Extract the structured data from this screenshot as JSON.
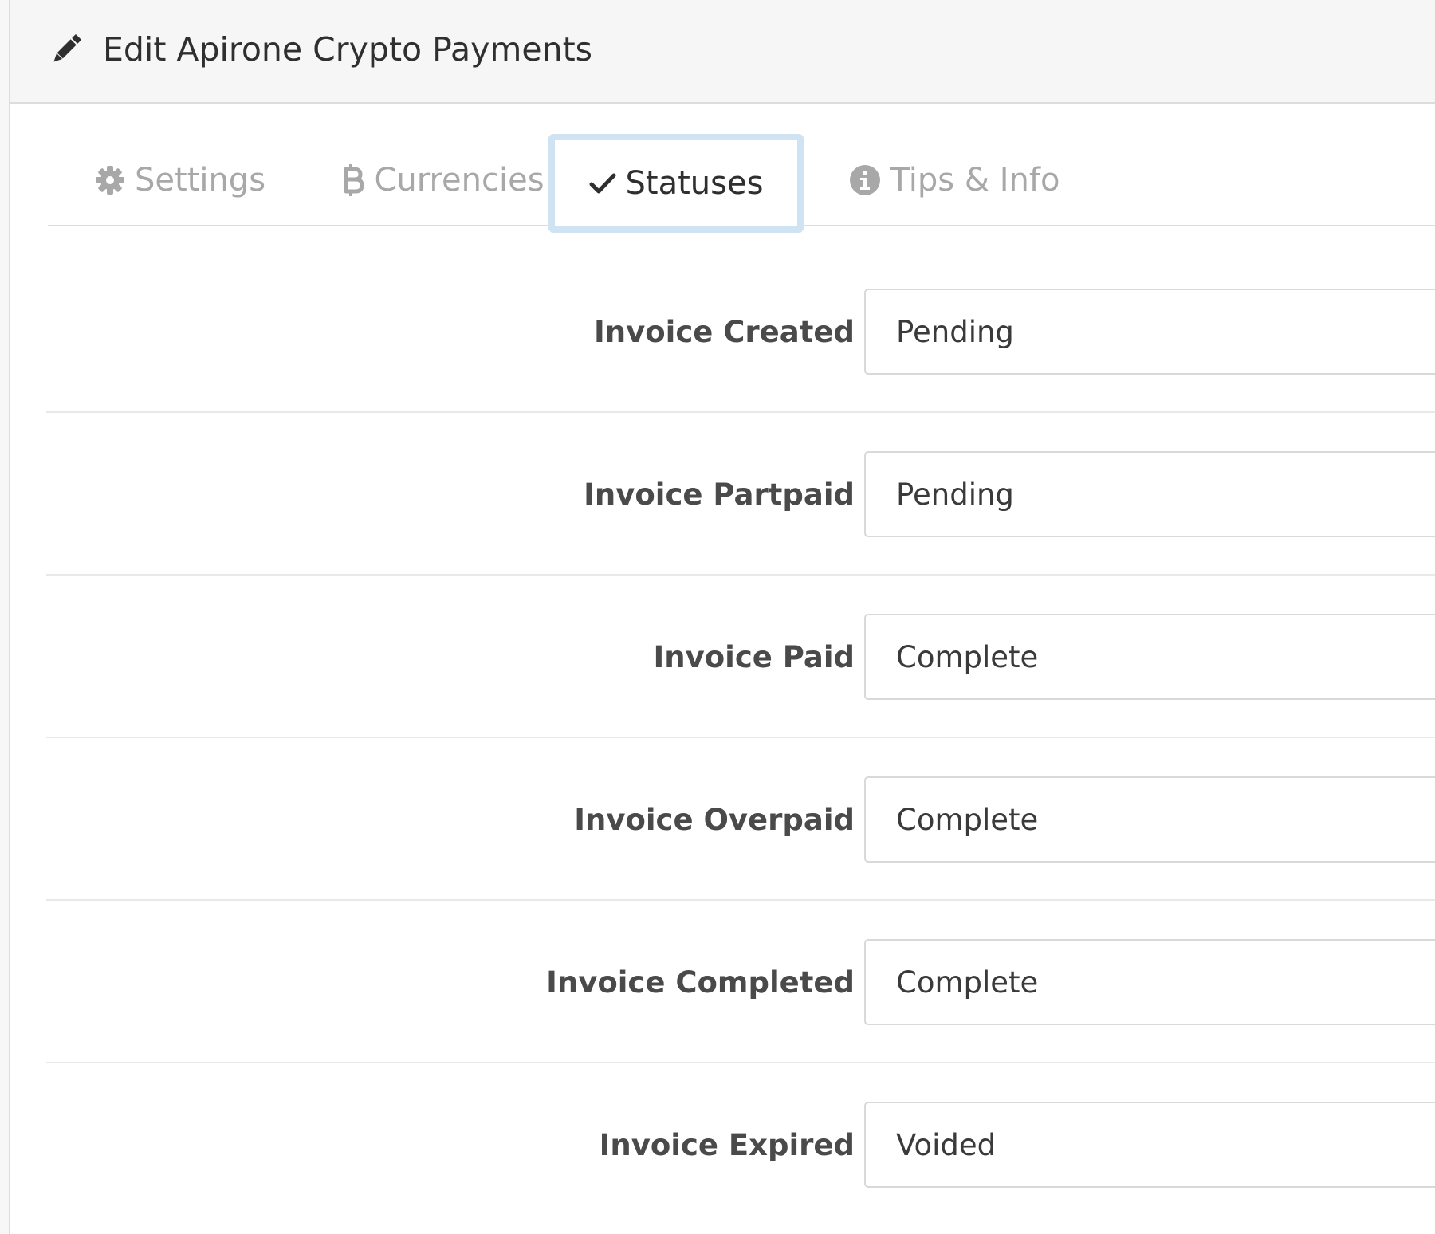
{
  "header": {
    "title": "Edit Apirone Crypto Payments",
    "icon": "pencil-icon"
  },
  "tabs": [
    {
      "label": "Settings",
      "icon": "gear-icon",
      "active": false
    },
    {
      "label": "Currencies",
      "icon": "bitcoin-icon",
      "active": false
    },
    {
      "label": "Statuses",
      "icon": "check-icon",
      "active": true
    },
    {
      "label": "Tips & Info",
      "icon": "info-circle-icon",
      "active": false
    }
  ],
  "statuses": [
    {
      "label": "Invoice Created",
      "value": "Pending"
    },
    {
      "label": "Invoice Partpaid",
      "value": "Pending"
    },
    {
      "label": "Invoice Paid",
      "value": "Complete"
    },
    {
      "label": "Invoice Overpaid",
      "value": "Complete"
    },
    {
      "label": "Invoice Completed",
      "value": "Complete"
    },
    {
      "label": "Invoice Expired",
      "value": "Voided"
    }
  ],
  "colors": {
    "active_tab_outline": "#cfe3f3",
    "inactive_tab_text": "#a8a8a8",
    "heading_background": "#f6f6f6"
  }
}
